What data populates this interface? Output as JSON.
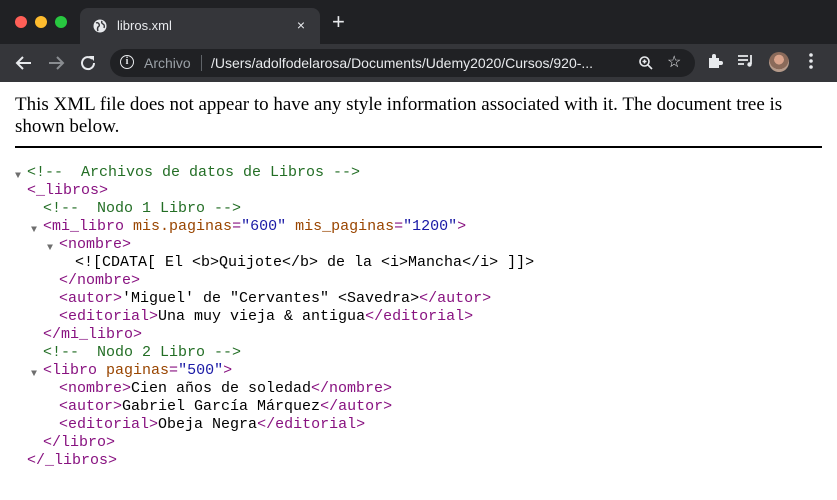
{
  "browser": {
    "tab_title": "libros.xml",
    "tab_close": "×",
    "new_tab": "+",
    "url_scheme_label": "Archivo",
    "url": "/Users/adolfodelarosa/Documents/Udemy2020/Cursos/920-...",
    "icons": [
      "globe-icon",
      "back-icon",
      "forward-icon",
      "reload-icon",
      "info-icon",
      "zoom-icon",
      "star-icon",
      "extensions-icon",
      "media-icon",
      "avatar",
      "menu-icon"
    ]
  },
  "page": {
    "notice": "This XML file does not appear to have any style information associated with it. The document tree is shown below."
  },
  "xml_tree": {
    "comment1": "<!--  Archivos de datos de Libros -->",
    "root_open": "<_libros>",
    "comment2": "<!--  Nodo 1 Libro -->",
    "mi_libro_open_start": "<mi_libro",
    "attr_mis_paginas_dot_name": "mis.paginas",
    "attr_mis_paginas_dot_value": "\"600\"",
    "attr_mis_paginas_name": "mis_paginas",
    "attr_mis_paginas_value": "\"1200\"",
    "mi_libro_open_end": ">",
    "nombre_open": "<nombre>",
    "cdata": "<![CDATA[ El <b>Quijote</b> de la <i>Mancha</i> ]]>",
    "nombre_close": "</nombre>",
    "autor_open": "<autor>",
    "autor1_text": "'Miguel' de \"Cervantes\" <Savedra>",
    "autor_close": "</autor>",
    "editorial_open": "<editorial>",
    "editorial1_text": "Una muy vieja & antigua",
    "editorial_close": "</editorial>",
    "mi_libro_close": "</mi_libro>",
    "comment3": "<!--  Nodo 2 Libro -->",
    "libro_open_start": "<libro",
    "attr_paginas_name": "paginas",
    "attr_paginas_value": "\"500\"",
    "libro_open_end": ">",
    "nombre2_text": "Cien años de soledad",
    "autor2_text": "Gabriel García Márquez",
    "editorial2_text": "Obeja Negra",
    "libro_close": "</libro>",
    "root_close": "</_libros>",
    "toggle_glyph": "▼",
    "eq": "=",
    "space": " "
  },
  "colors": {
    "comment": "#236e25",
    "tag": "#881280",
    "attribute_name": "#994500",
    "attribute_value": "#1a1aa6"
  }
}
